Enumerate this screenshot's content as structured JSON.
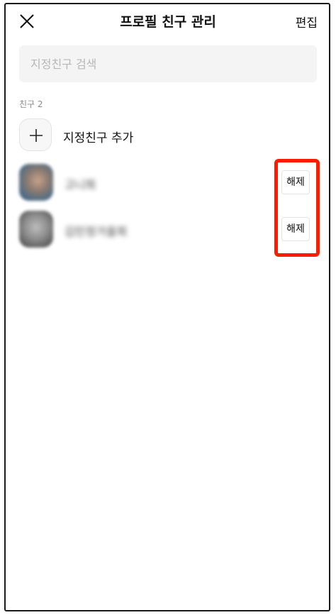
{
  "header": {
    "close_icon": "close-icon",
    "title": "프로필 친구 관리",
    "edit_label": "편집"
  },
  "search": {
    "placeholder": "지정친구 검색",
    "value": ""
  },
  "section": {
    "label": "친구 2"
  },
  "add_friend": {
    "icon": "plus-icon",
    "label": "지정친구 추가"
  },
  "friends": [
    {
      "name": "고니희",
      "action_label": "해제"
    },
    {
      "name": "김민정가을희",
      "action_label": "해제"
    }
  ],
  "annotation": {
    "color": "#ff1b00"
  }
}
